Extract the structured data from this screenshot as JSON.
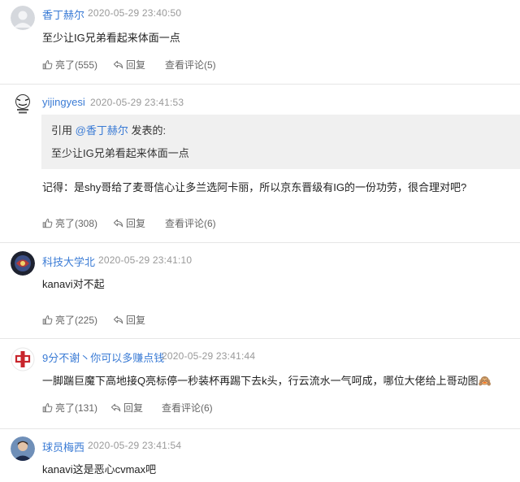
{
  "comments": [
    {
      "username": "香丁赫尔",
      "timestamp": "2020-05-29 23:40:50",
      "text": "至少让IG兄弟看起来体面一点",
      "actions": {
        "like": "亮了(555)",
        "reply": "回复",
        "view": "查看评论(5)"
      }
    },
    {
      "username": "yijingyesi",
      "timestamp": "2020-05-29 23:41:53",
      "quote": {
        "prefix": "引用",
        "ref_user": "@香丁赫尔",
        "suffix": "发表的:",
        "text": "至少让IG兄弟看起来体面一点"
      },
      "text": "记得：是shy哥给了麦哥信心让多兰选阿卡丽，所以京东晋级有IG的一份功劳，很合理对吧?",
      "actions": {
        "like": "亮了(308)",
        "reply": "回复",
        "view": "查看评论(6)"
      }
    },
    {
      "username": "科技大学北",
      "timestamp": "2020-05-29 23:41:10",
      "text": "kanavi对不起",
      "actions": {
        "like": "亮了(225)",
        "reply": "回复"
      }
    },
    {
      "username": "9分不谢丶你可以多赚点钱",
      "timestamp": "2020-05-29 23:41:44",
      "text": "一脚踹巨魔下高地接Q亮标停一秒装杯再踢下去k头，行云流水一气呵成，哪位大佬给上哥动图🙈",
      "actions": {
        "like": "亮了(131)",
        "reply": "回复",
        "view": "查看评论(6)"
      }
    },
    {
      "username": "球员梅西",
      "timestamp": "2020-05-29 23:41:54",
      "text": "kanavi这是恶心cvmax吧"
    }
  ],
  "icons": {
    "like": "thumbs-up-icon",
    "reply": "reply-arrow-icon"
  },
  "colors": {
    "username": "#3a7bd5",
    "timestamp": "#999999",
    "quote_bg": "#f0f0f0",
    "divider": "#e6e6e6"
  }
}
